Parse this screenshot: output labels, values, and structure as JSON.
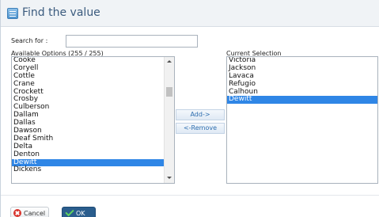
{
  "dialog": {
    "title": "Find the value",
    "search_label": "Search for :",
    "search_value": "",
    "available_label": "Available Options (255 / 255)",
    "current_label": "Current Selection",
    "add_button": "Add->",
    "remove_button": "<-Remove",
    "cancel_button": "Cancel",
    "ok_button": "OK"
  },
  "available_options": [
    {
      "label": "Cooke",
      "selected": false
    },
    {
      "label": "Coryell",
      "selected": false
    },
    {
      "label": "Cottle",
      "selected": false
    },
    {
      "label": "Crane",
      "selected": false
    },
    {
      "label": "Crockett",
      "selected": false
    },
    {
      "label": "Crosby",
      "selected": false
    },
    {
      "label": "Culberson",
      "selected": false
    },
    {
      "label": "Dallam",
      "selected": false
    },
    {
      "label": "Dallas",
      "selected": false
    },
    {
      "label": "Dawson",
      "selected": false
    },
    {
      "label": "Deaf Smith",
      "selected": false
    },
    {
      "label": "Delta",
      "selected": false
    },
    {
      "label": "Denton",
      "selected": false
    },
    {
      "label": "Dewitt",
      "selected": true
    },
    {
      "label": "Dickens",
      "selected": false
    }
  ],
  "current_selection": [
    {
      "label": "Victoria",
      "selected": false
    },
    {
      "label": "Jackson",
      "selected": false
    },
    {
      "label": "Lavaca",
      "selected": false
    },
    {
      "label": "Refugio",
      "selected": false
    },
    {
      "label": "Calhoun",
      "selected": false
    },
    {
      "label": "Dewitt",
      "selected": true
    }
  ],
  "colors": {
    "selection": "#2f86e6",
    "header_text": "#3b5b7e",
    "ok_button": "#2a5d8d"
  },
  "icons": [
    "list-icon",
    "cancel-icon",
    "check-icon",
    "scroll-up-icon",
    "scroll-down-icon"
  ]
}
